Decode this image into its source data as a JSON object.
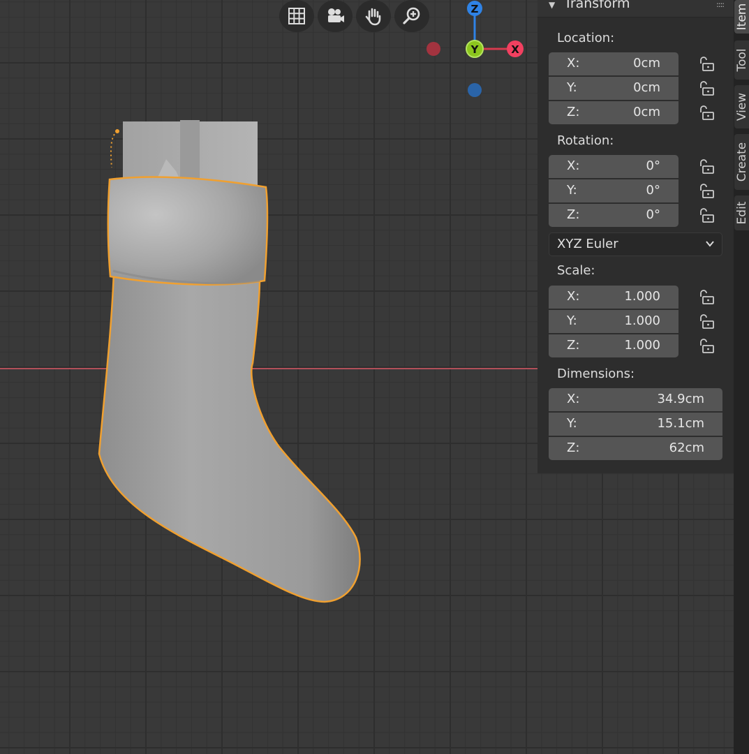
{
  "viewport": {
    "nav_buttons": [
      "grid-icon",
      "camera-icon",
      "hand-icon",
      "zoom-icon"
    ],
    "gizmo": {
      "z": "Z",
      "y": "Y",
      "x": "X"
    },
    "colors": {
      "selection": "#f0a030",
      "x_axis": "#c44a55",
      "y_axis": "#8cc61e",
      "z_axis": "#2f83e6",
      "grid_bg": "#393939"
    }
  },
  "panel": {
    "title": "Transform",
    "location": {
      "label": "Location:",
      "rows": [
        {
          "axis": "X:",
          "value": "0cm"
        },
        {
          "axis": "Y:",
          "value": "0cm"
        },
        {
          "axis": "Z:",
          "value": "0cm"
        }
      ]
    },
    "rotation": {
      "label": "Rotation:",
      "rows": [
        {
          "axis": "X:",
          "value": "0°"
        },
        {
          "axis": "Y:",
          "value": "0°"
        },
        {
          "axis": "Z:",
          "value": "0°"
        }
      ],
      "mode": "XYZ Euler"
    },
    "scale": {
      "label": "Scale:",
      "rows": [
        {
          "axis": "X:",
          "value": "1.000"
        },
        {
          "axis": "Y:",
          "value": "1.000"
        },
        {
          "axis": "Z:",
          "value": "1.000"
        }
      ]
    },
    "dimensions": {
      "label": "Dimensions:",
      "rows": [
        {
          "axis": "X:",
          "value": "34.9cm"
        },
        {
          "axis": "Y:",
          "value": "15.1cm"
        },
        {
          "axis": "Z:",
          "value": "62cm"
        }
      ]
    }
  },
  "tabs": [
    "Item",
    "Tool",
    "View",
    "Create",
    "Edit"
  ]
}
